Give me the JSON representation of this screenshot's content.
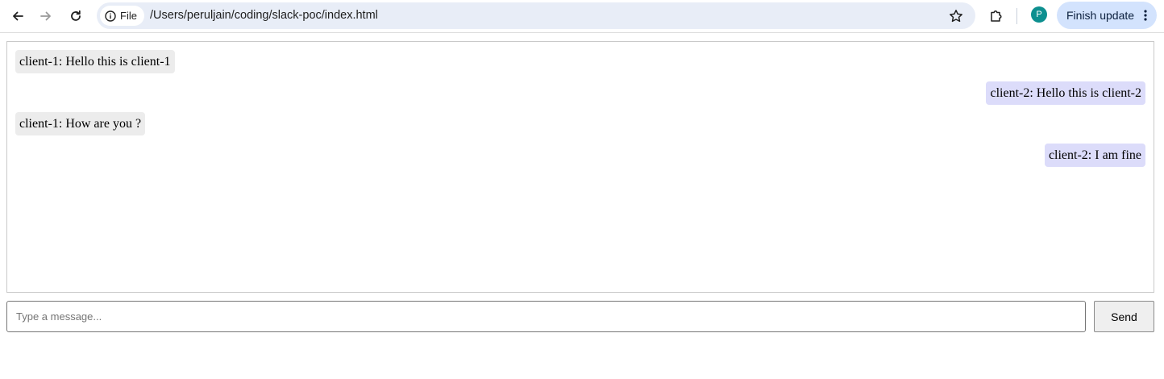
{
  "browser": {
    "back_icon": "arrow-left-icon",
    "forward_icon": "arrow-right-icon",
    "reload_icon": "reload-icon",
    "site_info_label": "File",
    "url": "/Users/peruljain/coding/slack-poc/index.html",
    "bookmark_icon": "star-icon",
    "extensions_icon": "puzzle-icon",
    "profile_initial": "P",
    "profile_color": "#0d8f8f",
    "update_button_label": "Finish update",
    "menu_icon": "more-vert-icon"
  },
  "chat": {
    "messages": [
      {
        "side": "left",
        "text": "client-1: Hello this is client-1"
      },
      {
        "side": "right",
        "text": "client-2: Hello this is client-2"
      },
      {
        "side": "left",
        "text": "client-1: How are you ?"
      },
      {
        "side": "right",
        "text": "client-2: I am fine"
      }
    ],
    "incoming_color": "#ececec",
    "outgoing_color": "#dcdcfa"
  },
  "composer": {
    "placeholder": "Type a message...",
    "value": "",
    "send_label": "Send"
  }
}
